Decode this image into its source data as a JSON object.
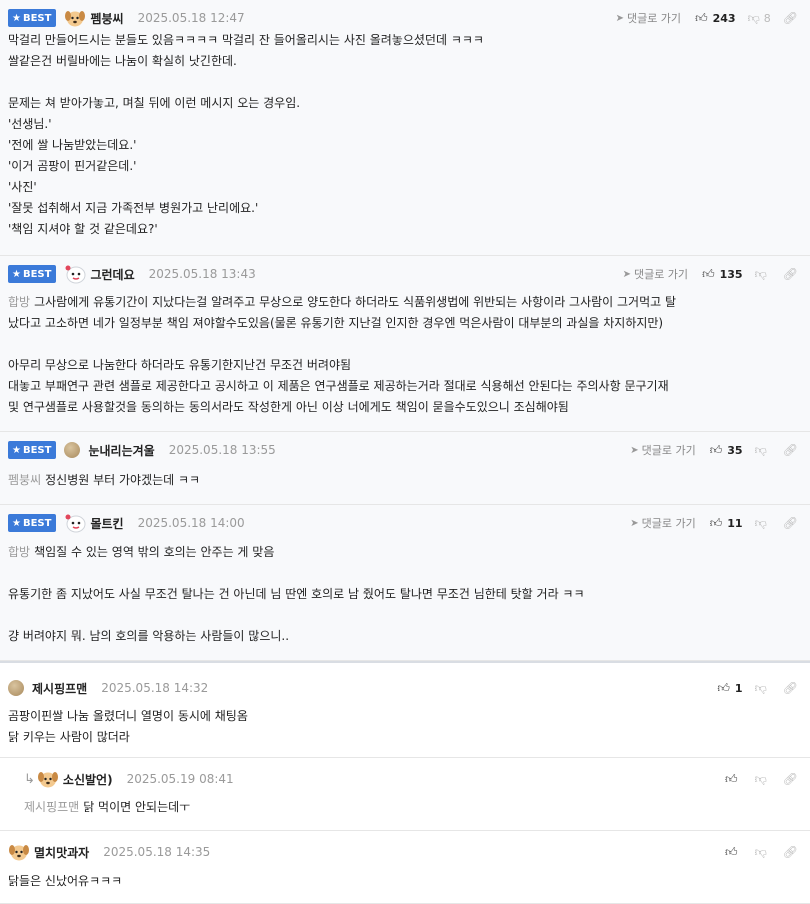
{
  "labels": {
    "best": "BEST",
    "goto_reply": "댓글로 가기"
  },
  "comments": [
    {
      "nick": "펨붕씨",
      "date": "2025.05.18 12:47",
      "up": "243",
      "down": "8",
      "lines": [
        "막걸리 만들어드시는 분들도 있음ㅋㅋㅋㅋ 막걸리 잔 들어올리시는 사진 올려놓으셨던데 ㅋㅋㅋ",
        "쌀같은건 버릴바에는 나눔이 확실히 낫긴한데.",
        "",
        "문제는 쳐 받아가놓고, 며칠 뒤에 이런 메시지 오는 경우임.",
        "'선생님.'",
        "'전에 쌀 나눔받았는데요.'",
        "'이거 곰팡이 핀거같은데.'",
        "'사진'",
        "'잘못 섭취해서 지금 가족전부 병원가고 난리에요.'",
        "'책임 지셔야 할 것 같은데요?'"
      ]
    },
    {
      "nick": "그런데요",
      "date": "2025.05.18 13:43",
      "up": "135",
      "mention": "합방",
      "lines": [
        "그사람에게 유통기간이 지났다는걸 알려주고 무상으로 양도한다 하더라도 식품위생법에 위반되는 사항이라 그사람이 그거먹고 탈",
        "났다고 고소하면 네가 일정부분 책임 져야할수도있음(물론 유통기한 지난걸 인지한 경우엔 먹은사람이 대부분의 과실을 차지하지만)",
        "",
        "아무리 무상으로 나눔한다 하더라도 유통기한지난건 무조건 버려야됨",
        "대놓고 부패연구 관련 샘플로 제공한다고 공시하고 이 제품은 연구샘플로 제공하는거라 절대로 식용해선 안된다는 주의사항 문구기재",
        "및 연구샘플로 사용할것을 동의하는 동의서라도 작성한게 아닌 이상 너에게도 책임이 묻을수도있으니 조심해야됨"
      ]
    },
    {
      "nick": "눈내리는겨울",
      "date": "2025.05.18 13:55",
      "up": "35",
      "mention": "펨붕씨",
      "lines": [
        "정신병원 부터 가야겠는데 ㅋㅋ"
      ]
    },
    {
      "nick": "몰트킨",
      "date": "2025.05.18 14:00",
      "up": "11",
      "mention": "합방",
      "lines": [
        "책임질 수 있는 영역 밖의 호의는 안주는 게 맞음",
        "",
        "유통기한 좀 지났어도 사실 무조건 탈나는 건 아닌데 님 딴엔 호의로 남 줬어도 탈나면 무조건 님한테 탓할 거라 ㅋㅋ",
        "",
        "걍 버려야지 뭐. 남의 호의를 악용하는 사람들이 많으니.."
      ]
    },
    {
      "nick": "제시핑프맨",
      "date": "2025.05.18 14:32",
      "up": "1",
      "lines": [
        "곰팡이핀쌀 나눔 올렸더니 열명이 동시에 채팅옴",
        "닭 키우는 사람이 많더라"
      ]
    },
    {
      "nick": "소신발언)",
      "date": "2025.05.19 08:41",
      "mention": "제시핑프맨",
      "lines": [
        "닭 먹이면 안되는데ㅜ"
      ]
    },
    {
      "nick": "멸치맛과자",
      "date": "2025.05.18 14:35",
      "lines": [
        "닭들은 신났어유ㅋㅋㅋ"
      ]
    }
  ]
}
